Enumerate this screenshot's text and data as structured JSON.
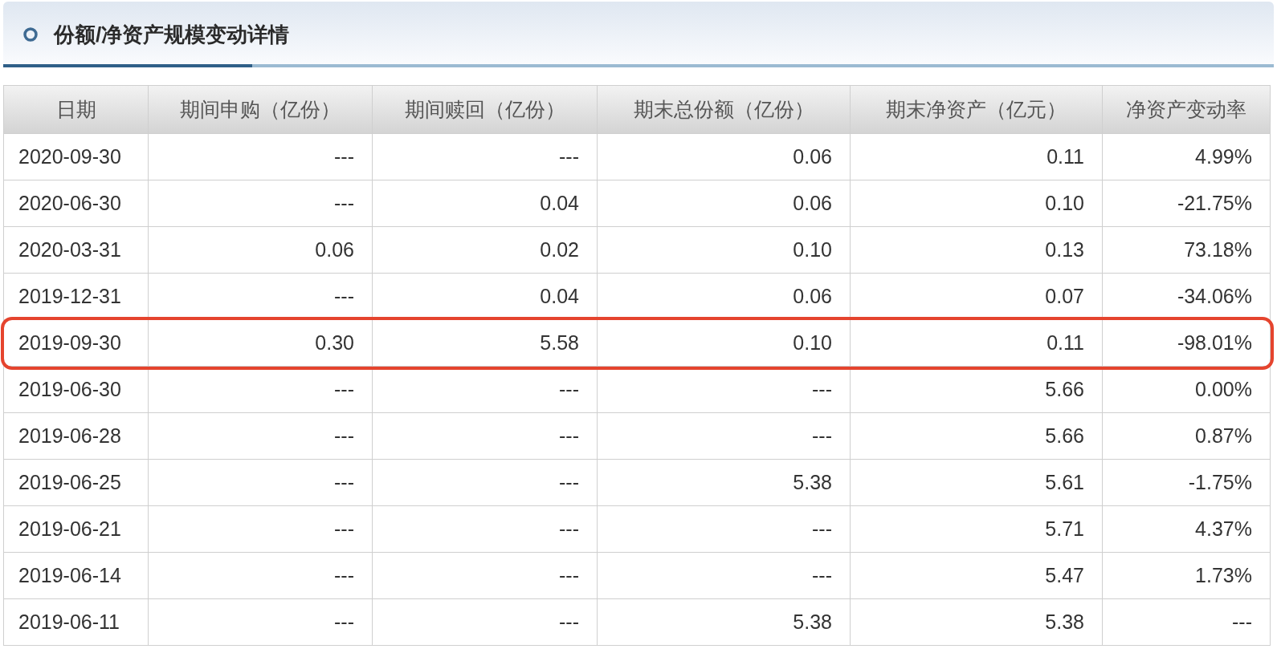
{
  "panel": {
    "title": "份额/净资产规模变动详情"
  },
  "table": {
    "columns": [
      "日期",
      "期间申购（亿份）",
      "期间赎回（亿份）",
      "期末总份额（亿份）",
      "期末净资产（亿元）",
      "净资产变动率"
    ],
    "rows": [
      {
        "cells": [
          "2020-09-30",
          "---",
          "---",
          "0.06",
          "0.11",
          "4.99%"
        ],
        "highlighted": false
      },
      {
        "cells": [
          "2020-06-30",
          "---",
          "0.04",
          "0.06",
          "0.10",
          "-21.75%"
        ],
        "highlighted": false
      },
      {
        "cells": [
          "2020-03-31",
          "0.06",
          "0.02",
          "0.10",
          "0.13",
          "73.18%"
        ],
        "highlighted": false
      },
      {
        "cells": [
          "2019-12-31",
          "---",
          "0.04",
          "0.06",
          "0.07",
          "-34.06%"
        ],
        "highlighted": false
      },
      {
        "cells": [
          "2019-09-30",
          "0.30",
          "5.58",
          "0.10",
          "0.11",
          "-98.01%"
        ],
        "highlighted": true
      },
      {
        "cells": [
          "2019-06-30",
          "---",
          "---",
          "---",
          "5.66",
          "0.00%"
        ],
        "highlighted": false
      },
      {
        "cells": [
          "2019-06-28",
          "---",
          "---",
          "---",
          "5.66",
          "0.87%"
        ],
        "highlighted": false
      },
      {
        "cells": [
          "2019-06-25",
          "---",
          "---",
          "5.38",
          "5.61",
          "-1.75%"
        ],
        "highlighted": false
      },
      {
        "cells": [
          "2019-06-21",
          "---",
          "---",
          "---",
          "5.71",
          "4.37%"
        ],
        "highlighted": false
      },
      {
        "cells": [
          "2019-06-14",
          "---",
          "---",
          "---",
          "5.47",
          "1.73%"
        ],
        "highlighted": false
      },
      {
        "cells": [
          "2019-06-11",
          "---",
          "---",
          "5.38",
          "5.38",
          "---"
        ],
        "highlighted": false
      }
    ]
  }
}
